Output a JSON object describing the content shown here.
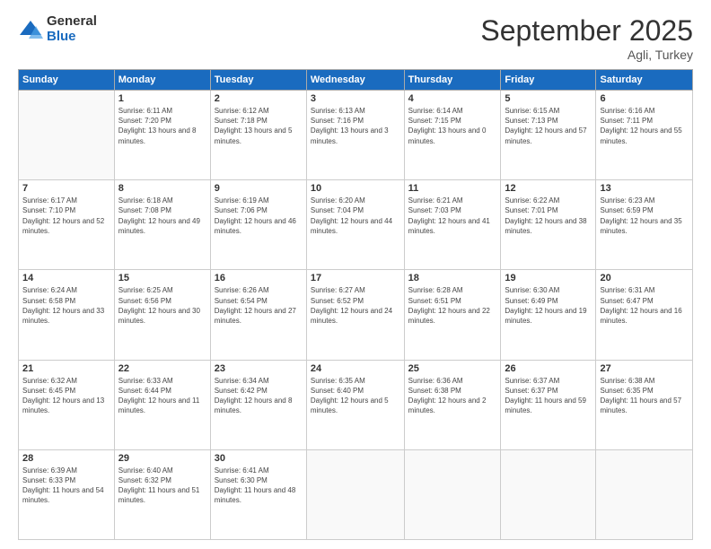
{
  "logo": {
    "general": "General",
    "blue": "Blue"
  },
  "title": "September 2025",
  "subtitle": "Agli, Turkey",
  "days_of_week": [
    "Sunday",
    "Monday",
    "Tuesday",
    "Wednesday",
    "Thursday",
    "Friday",
    "Saturday"
  ],
  "weeks": [
    [
      {
        "day": "",
        "sunrise": "",
        "sunset": "",
        "daylight": ""
      },
      {
        "day": "1",
        "sunrise": "Sunrise: 6:11 AM",
        "sunset": "Sunset: 7:20 PM",
        "daylight": "Daylight: 13 hours and 8 minutes."
      },
      {
        "day": "2",
        "sunrise": "Sunrise: 6:12 AM",
        "sunset": "Sunset: 7:18 PM",
        "daylight": "Daylight: 13 hours and 5 minutes."
      },
      {
        "day": "3",
        "sunrise": "Sunrise: 6:13 AM",
        "sunset": "Sunset: 7:16 PM",
        "daylight": "Daylight: 13 hours and 3 minutes."
      },
      {
        "day": "4",
        "sunrise": "Sunrise: 6:14 AM",
        "sunset": "Sunset: 7:15 PM",
        "daylight": "Daylight: 13 hours and 0 minutes."
      },
      {
        "day": "5",
        "sunrise": "Sunrise: 6:15 AM",
        "sunset": "Sunset: 7:13 PM",
        "daylight": "Daylight: 12 hours and 57 minutes."
      },
      {
        "day": "6",
        "sunrise": "Sunrise: 6:16 AM",
        "sunset": "Sunset: 7:11 PM",
        "daylight": "Daylight: 12 hours and 55 minutes."
      }
    ],
    [
      {
        "day": "7",
        "sunrise": "Sunrise: 6:17 AM",
        "sunset": "Sunset: 7:10 PM",
        "daylight": "Daylight: 12 hours and 52 minutes."
      },
      {
        "day": "8",
        "sunrise": "Sunrise: 6:18 AM",
        "sunset": "Sunset: 7:08 PM",
        "daylight": "Daylight: 12 hours and 49 minutes."
      },
      {
        "day": "9",
        "sunrise": "Sunrise: 6:19 AM",
        "sunset": "Sunset: 7:06 PM",
        "daylight": "Daylight: 12 hours and 46 minutes."
      },
      {
        "day": "10",
        "sunrise": "Sunrise: 6:20 AM",
        "sunset": "Sunset: 7:04 PM",
        "daylight": "Daylight: 12 hours and 44 minutes."
      },
      {
        "day": "11",
        "sunrise": "Sunrise: 6:21 AM",
        "sunset": "Sunset: 7:03 PM",
        "daylight": "Daylight: 12 hours and 41 minutes."
      },
      {
        "day": "12",
        "sunrise": "Sunrise: 6:22 AM",
        "sunset": "Sunset: 7:01 PM",
        "daylight": "Daylight: 12 hours and 38 minutes."
      },
      {
        "day": "13",
        "sunrise": "Sunrise: 6:23 AM",
        "sunset": "Sunset: 6:59 PM",
        "daylight": "Daylight: 12 hours and 35 minutes."
      }
    ],
    [
      {
        "day": "14",
        "sunrise": "Sunrise: 6:24 AM",
        "sunset": "Sunset: 6:58 PM",
        "daylight": "Daylight: 12 hours and 33 minutes."
      },
      {
        "day": "15",
        "sunrise": "Sunrise: 6:25 AM",
        "sunset": "Sunset: 6:56 PM",
        "daylight": "Daylight: 12 hours and 30 minutes."
      },
      {
        "day": "16",
        "sunrise": "Sunrise: 6:26 AM",
        "sunset": "Sunset: 6:54 PM",
        "daylight": "Daylight: 12 hours and 27 minutes."
      },
      {
        "day": "17",
        "sunrise": "Sunrise: 6:27 AM",
        "sunset": "Sunset: 6:52 PM",
        "daylight": "Daylight: 12 hours and 24 minutes."
      },
      {
        "day": "18",
        "sunrise": "Sunrise: 6:28 AM",
        "sunset": "Sunset: 6:51 PM",
        "daylight": "Daylight: 12 hours and 22 minutes."
      },
      {
        "day": "19",
        "sunrise": "Sunrise: 6:30 AM",
        "sunset": "Sunset: 6:49 PM",
        "daylight": "Daylight: 12 hours and 19 minutes."
      },
      {
        "day": "20",
        "sunrise": "Sunrise: 6:31 AM",
        "sunset": "Sunset: 6:47 PM",
        "daylight": "Daylight: 12 hours and 16 minutes."
      }
    ],
    [
      {
        "day": "21",
        "sunrise": "Sunrise: 6:32 AM",
        "sunset": "Sunset: 6:45 PM",
        "daylight": "Daylight: 12 hours and 13 minutes."
      },
      {
        "day": "22",
        "sunrise": "Sunrise: 6:33 AM",
        "sunset": "Sunset: 6:44 PM",
        "daylight": "Daylight: 12 hours and 11 minutes."
      },
      {
        "day": "23",
        "sunrise": "Sunrise: 6:34 AM",
        "sunset": "Sunset: 6:42 PM",
        "daylight": "Daylight: 12 hours and 8 minutes."
      },
      {
        "day": "24",
        "sunrise": "Sunrise: 6:35 AM",
        "sunset": "Sunset: 6:40 PM",
        "daylight": "Daylight: 12 hours and 5 minutes."
      },
      {
        "day": "25",
        "sunrise": "Sunrise: 6:36 AM",
        "sunset": "Sunset: 6:38 PM",
        "daylight": "Daylight: 12 hours and 2 minutes."
      },
      {
        "day": "26",
        "sunrise": "Sunrise: 6:37 AM",
        "sunset": "Sunset: 6:37 PM",
        "daylight": "Daylight: 11 hours and 59 minutes."
      },
      {
        "day": "27",
        "sunrise": "Sunrise: 6:38 AM",
        "sunset": "Sunset: 6:35 PM",
        "daylight": "Daylight: 11 hours and 57 minutes."
      }
    ],
    [
      {
        "day": "28",
        "sunrise": "Sunrise: 6:39 AM",
        "sunset": "Sunset: 6:33 PM",
        "daylight": "Daylight: 11 hours and 54 minutes."
      },
      {
        "day": "29",
        "sunrise": "Sunrise: 6:40 AM",
        "sunset": "Sunset: 6:32 PM",
        "daylight": "Daylight: 11 hours and 51 minutes."
      },
      {
        "day": "30",
        "sunrise": "Sunrise: 6:41 AM",
        "sunset": "Sunset: 6:30 PM",
        "daylight": "Daylight: 11 hours and 48 minutes."
      },
      {
        "day": "",
        "sunrise": "",
        "sunset": "",
        "daylight": ""
      },
      {
        "day": "",
        "sunrise": "",
        "sunset": "",
        "daylight": ""
      },
      {
        "day": "",
        "sunrise": "",
        "sunset": "",
        "daylight": ""
      },
      {
        "day": "",
        "sunrise": "",
        "sunset": "",
        "daylight": ""
      }
    ]
  ]
}
